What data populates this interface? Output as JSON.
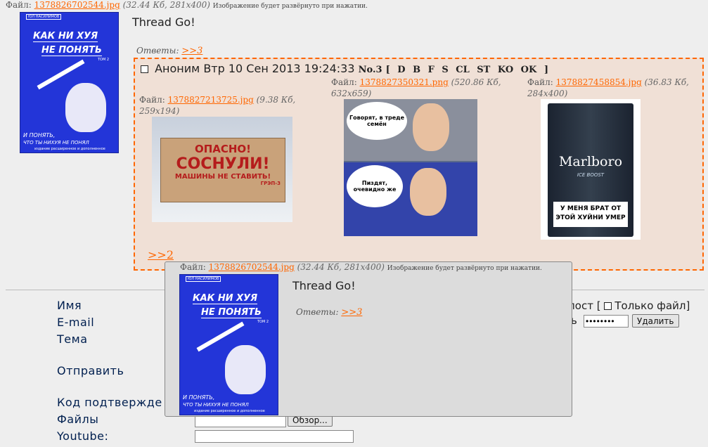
{
  "op": {
    "file_label": "Файл:",
    "file_name": "1378826702544.jpg",
    "file_meta": "(32.44 Кб, 281x400)",
    "file_note": "Изображение будет развёрнуто при нажатии.",
    "text": "Thread Go!",
    "replies_label": "Ответы:",
    "replies_link": ">>3",
    "cover": {
      "author": "ЮЛ НАСИЛИМОВ",
      "title1": "КАК НИ ХУЯ",
      "title2": "НЕ ПОНЯТЬ",
      "volume": "ТОМ 2",
      "bottom1": "И ПОНЯТЬ,",
      "bottom2": "ЧТО ТЫ НИХУЯ НЕ ПОНЯЛ",
      "bottom3": "издание расширенное и дополненное"
    }
  },
  "reply": {
    "name": "Аноним",
    "date": "Втр 10 Сен 2013 19:24:33",
    "num": "No.3",
    "actions": "[ D B F S CL ST KO OK ]",
    "backlink": ">>2",
    "files": [
      {
        "label": "Файл:",
        "name": "1378827213725.jpg",
        "meta1": "(9.38 Кб,",
        "meta2": "259x194)",
        "img_text1": "ОПАСНО!",
        "img_text2": "СОСНУЛИ!",
        "img_text3": "МАШИНЫ НЕ СТАВИТЬ!",
        "img_text4": "ГРЭП-3"
      },
      {
        "label": "Файл:",
        "name": "1378827350321.png",
        "meta1": "(520.86 Кб,",
        "meta2": "632x659)",
        "img_text1": "Говорят, в треде семён",
        "img_text2": "Пиздят, очевидно же"
      },
      {
        "label": "Файл:",
        "name": "1378827458854.jpg",
        "meta1": "(36.83 Кб,",
        "meta2": "284x400)",
        "img_text1": "Marlboro",
        "img_text2": "ICE BOOST",
        "img_text3": "У МЕНЯ БРАТ ОТ ЭТОЙ ХУЙНИ УМЕР"
      }
    ]
  },
  "popup": {
    "file_label": "Файл:",
    "file_name": "1378826702544.jpg",
    "file_meta": "(32.44 Кб, 281x400)",
    "file_note": "Изображение будет развёрнуто при нажатии.",
    "text": "Thread Go!",
    "replies_label": "Ответы:",
    "replies_link": ">>3"
  },
  "form": {
    "name_label": "Имя",
    "email_label": "E-mail",
    "subject_label": "Тема",
    "submit_label": "Отправить",
    "captcha_label": "Код подтвержде",
    "files_label": "Файлы",
    "youtube_label": "Youtube:",
    "browse_label": "Обзор..."
  },
  "delete": {
    "post_text": "пост [",
    "file_only": "Только файл]",
    "pw_prefix": "ь",
    "password_value": "••••••••",
    "delete_button": "Удалить"
  },
  "colors": {
    "accent": "#ff6600",
    "reply_bg": "#f0e0d6",
    "page_bg": "#eeeeee",
    "label": "#001f4f"
  }
}
